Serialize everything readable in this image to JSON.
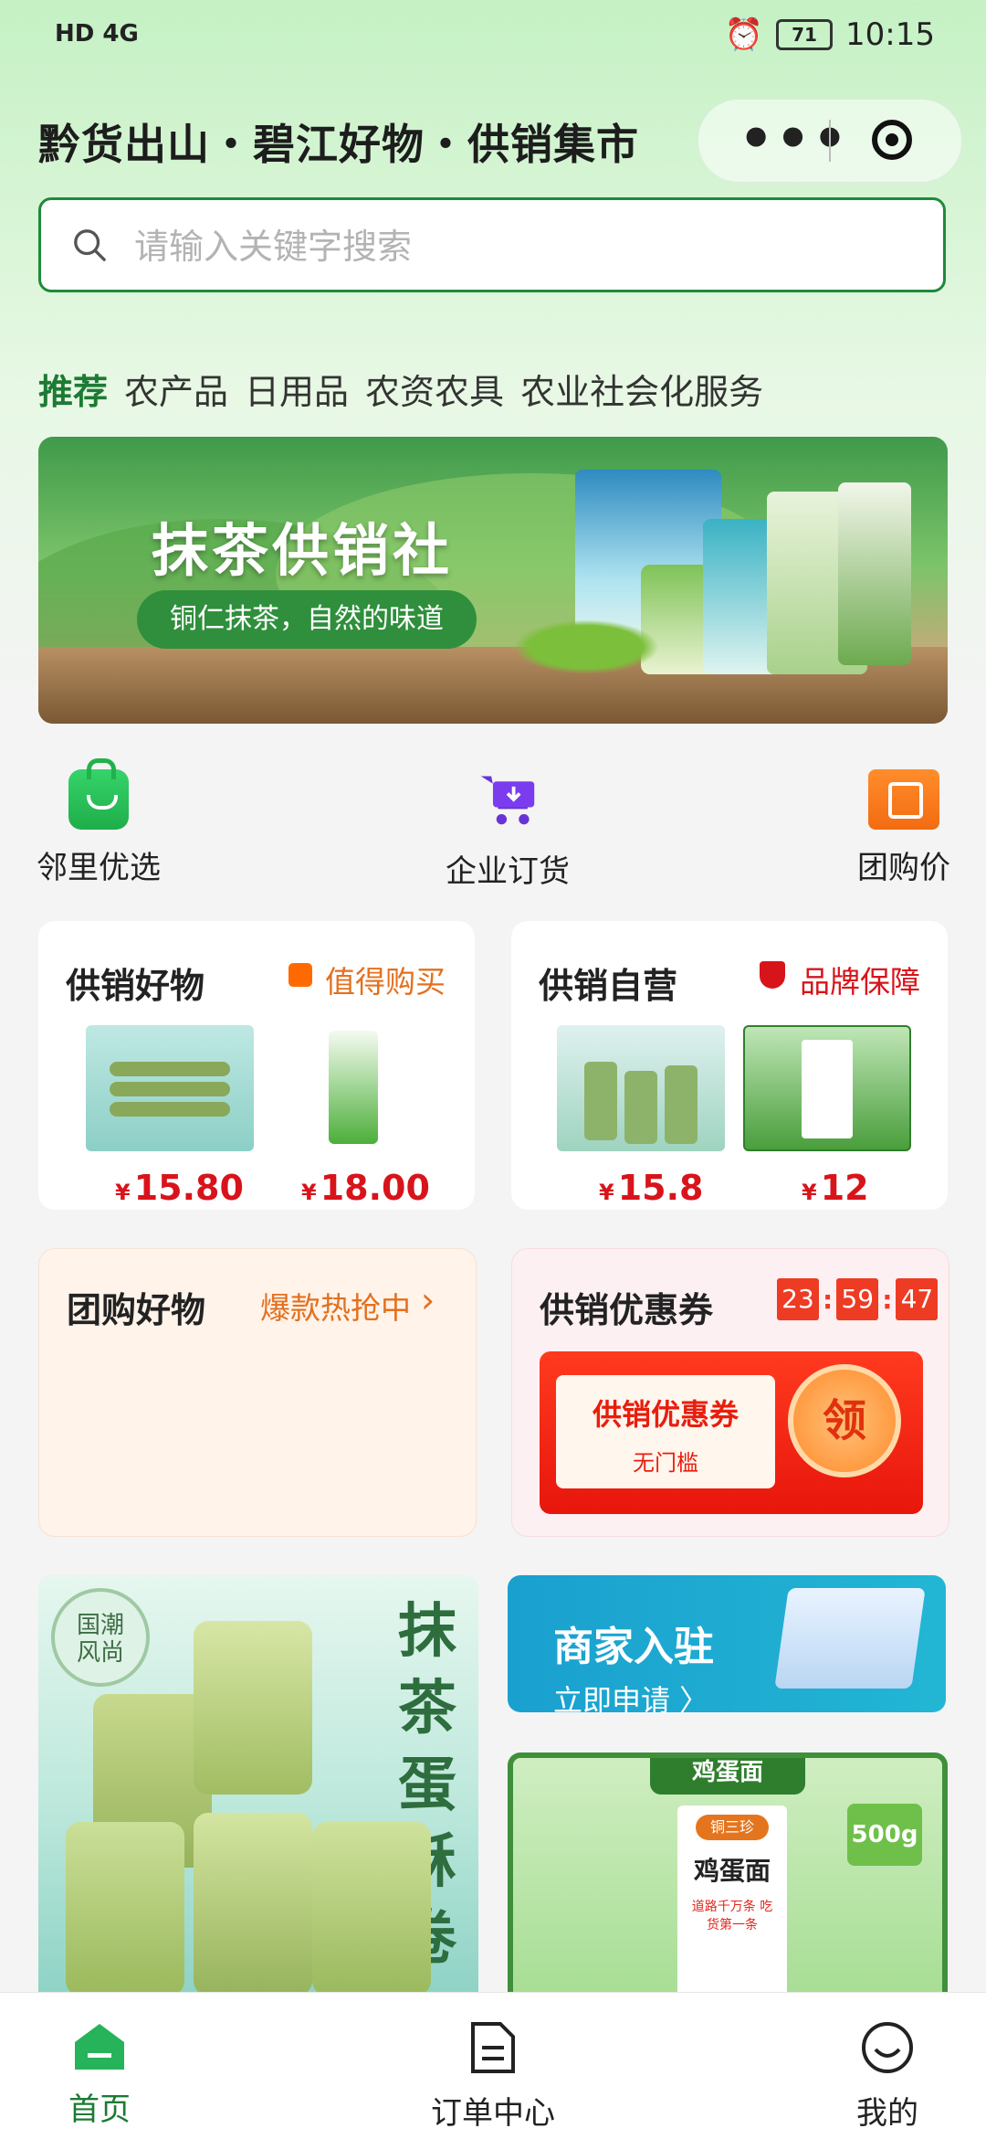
{
  "status_bar": {
    "left": "HD 4G",
    "battery": "71",
    "time": "10:15"
  },
  "header": {
    "title": "黔货出山・碧江好物・供销集市"
  },
  "search": {
    "placeholder": "请输入关键字搜索"
  },
  "categories": [
    {
      "label": "推荐",
      "active": true
    },
    {
      "label": "农产品",
      "active": false
    },
    {
      "label": "日用品",
      "active": false
    },
    {
      "label": "农资农具",
      "active": false
    },
    {
      "label": "农业社会化服务",
      "active": false
    }
  ],
  "banner": {
    "title": "抹茶供销社",
    "subtitle": "铜仁抹茶，自然的味道"
  },
  "quick_links": [
    {
      "label": "邻里优选",
      "icon": "shopping-bag-icon"
    },
    {
      "label": "企业订货",
      "icon": "cart-icon"
    },
    {
      "label": "团购价",
      "icon": "group-buy-ticket-icon"
    }
  ],
  "cards": {
    "good_items": {
      "title": "供销好物",
      "tag": "值得购买",
      "tag_icon": "bag-icon",
      "products": [
        {
          "currency": "¥",
          "price": "15.80"
        },
        {
          "currency": "¥",
          "price": "18.00"
        }
      ]
    },
    "self_run": {
      "title": "供销自营",
      "tag": "品牌保障",
      "tag_icon": "shield-icon",
      "products": [
        {
          "currency": "¥",
          "price": "15.8"
        },
        {
          "currency": "¥",
          "price": "12"
        }
      ]
    },
    "group_buy": {
      "title": "团购好物",
      "tag": "爆款热抢中"
    },
    "coupon": {
      "title": "供销优惠券",
      "timer": [
        "23",
        "59",
        "47"
      ],
      "coupon_name": "供销优惠券",
      "coupon_note": "无门槛",
      "claim": "领"
    }
  },
  "promos": {
    "matcha_rolls": {
      "badge": "国潮风尚",
      "title": "抹茶蛋酥卷"
    },
    "merchant": {
      "title": "商家入驻",
      "action": "立即申请 〉"
    },
    "egg_noodles": {
      "ribbon": "鸡蛋面",
      "weight": "500g",
      "brand": "铜三珍",
      "name": "鸡蛋面",
      "slogan": "道路千万条 吃货第一条"
    }
  },
  "tabbar": [
    {
      "label": "首页",
      "icon": "home-icon",
      "active": true
    },
    {
      "label": "订单中心",
      "icon": "order-icon",
      "active": false
    },
    {
      "label": "我的",
      "icon": "profile-icon",
      "active": false
    }
  ],
  "colors": {
    "accent": "#1d7a34",
    "price": "#d8141b",
    "tag_orange": "#e4701e",
    "tag_red": "#d8141b"
  }
}
